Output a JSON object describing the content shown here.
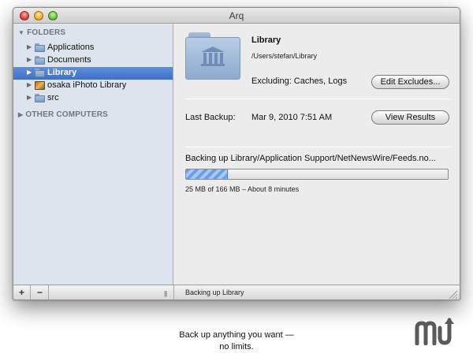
{
  "window": {
    "title": "Arq"
  },
  "sidebar": {
    "folders_header": "FOLDERS",
    "items": [
      {
        "label": "Applications",
        "icon": "applications-folder-icon"
      },
      {
        "label": "Documents",
        "icon": "folder-icon"
      },
      {
        "label": "Library",
        "icon": "folder-icon",
        "selected": true
      },
      {
        "label": "osaka iPhoto Library",
        "icon": "iphoto-library-icon"
      },
      {
        "label": "src",
        "icon": "folder-icon"
      }
    ],
    "other_header": "OTHER COMPUTERS"
  },
  "bottombar": {
    "add_label": "+",
    "remove_label": "−",
    "status": "Backing up Library"
  },
  "detail": {
    "name": "Library",
    "path": "/Users/stefan/Library",
    "excluding": "Excluding: Caches, Logs",
    "edit_excludes_label": "Edit Excludes...",
    "last_backup_label": "Last Backup:",
    "last_backup_value": "Mar 9, 2010 7:51 AM",
    "view_results_label": "View Results",
    "progress_text": "Backing up Library/Application Support/NetNewsWire/Feeds.no...",
    "progress_fraction": 0.16,
    "progress_detail": "25 MB of 166 MB – About 8 minutes"
  },
  "caption": {
    "line1": "Back up anything you want —",
    "line2": "no limits."
  },
  "colors": {
    "selection": "#3e6fc6",
    "sidebar_bg": "#dde4ed",
    "progress_fill": "#6b9ee8"
  }
}
